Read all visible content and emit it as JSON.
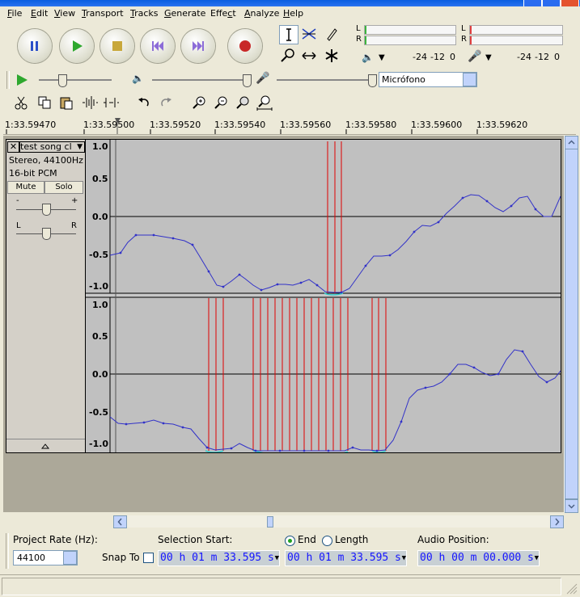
{
  "menu": [
    "File",
    "Edit",
    "View",
    "Transport",
    "Tracks",
    "Generate",
    "Effect",
    "Analyze",
    "Help"
  ],
  "menu_underline": [
    "F",
    "E",
    "V",
    "T",
    "T",
    "G",
    "c",
    "A",
    "H"
  ],
  "meters": {
    "play_L": "L",
    "play_R": "R",
    "rec_L": "L",
    "rec_R": "R",
    "play_scale": [
      "-24",
      "-12",
      "0"
    ],
    "rec_scale": [
      "-24",
      "-12",
      "0"
    ]
  },
  "mixer": {
    "input_source": "Micrófono"
  },
  "ruler": {
    "labels": [
      "1:33.59470",
      "1:33.59500",
      "1:33.59520",
      "1:33.59540",
      "1:33.59560",
      "1:33.59580",
      "1:33.59600",
      "1:33.59620"
    ]
  },
  "track": {
    "name": "test song cl",
    "info1": "Stereo, 44100Hz",
    "info2": "16-bit PCM",
    "mute": "Mute",
    "solo": "Solo",
    "gain_minus": "-",
    "gain_plus": "+",
    "pan_left": "L",
    "pan_right": "R"
  },
  "channels": [
    {
      "y_labels": [
        "1.0",
        "0.5",
        "0.0",
        "-0.5",
        "-1.0"
      ]
    },
    {
      "y_labels": [
        "1.0",
        "0.5",
        "0.0",
        "-0.5",
        "-1.0"
      ]
    }
  ],
  "status": {
    "project_rate_label": "Project Rate (Hz):",
    "project_rate_value": "44100",
    "snap_to": "Snap To",
    "selection_start_label": "Selection Start:",
    "end_label": "End",
    "length_label": "Length",
    "audio_position_label": "Audio Position:",
    "selection_start": "00 h 01 m 33.595 s",
    "selection_end": "00 h 01 m 33.595 s",
    "audio_position": "00 h 00 m 00.000 s"
  },
  "colors": {
    "waveform": "#3232c8",
    "selection_line": "#e00000",
    "clip_line": "#33cccc"
  }
}
